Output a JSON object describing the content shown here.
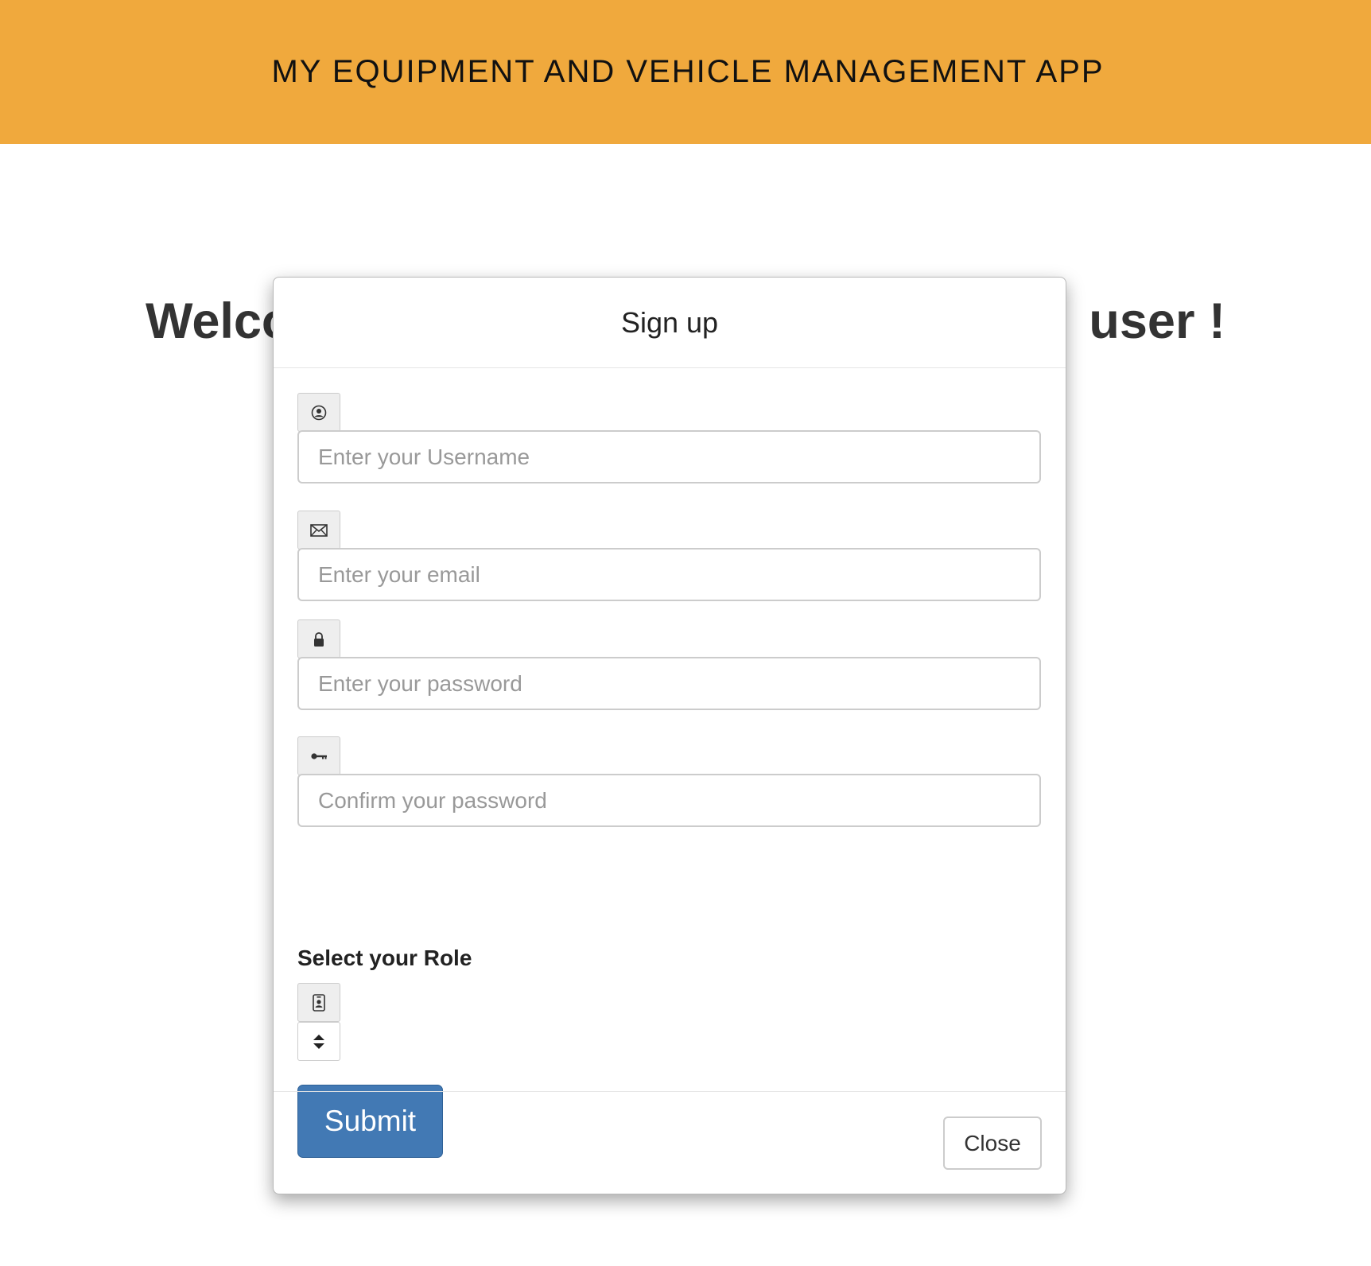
{
  "header": {
    "title": "MY EQUIPMENT AND VEHICLE MANAGEMENT APP"
  },
  "welcome": {
    "text_left": "Welco",
    "text_right": "user !"
  },
  "modal": {
    "title": "Sign up",
    "fields": {
      "username": {
        "placeholder": "Enter your Username",
        "icon": "user-circle-icon"
      },
      "email": {
        "placeholder": "Enter your email",
        "icon": "envelope-icon"
      },
      "password": {
        "placeholder": "Enter your password",
        "icon": "lock-icon"
      },
      "confirm": {
        "placeholder": "Confirm your password",
        "icon": "key-icon"
      }
    },
    "role": {
      "label": "Select your Role",
      "icon": "id-badge-icon",
      "select_icon": "sort-arrows-icon"
    },
    "submit_label": "Submit",
    "close_label": "Close"
  },
  "colors": {
    "header_bg": "#f0a93d",
    "primary_button": "#4279b4"
  }
}
